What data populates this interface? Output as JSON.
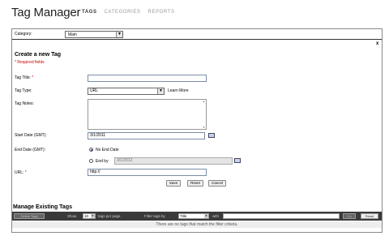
{
  "header": {
    "title": "Tag Manager",
    "tabs": [
      {
        "label": "TAGS"
      },
      {
        "label": "CATEGORIES"
      },
      {
        "label": "REPORTS"
      }
    ]
  },
  "category_bar": {
    "label": "Category:",
    "selected": "Main"
  },
  "close_label": "x",
  "create_form": {
    "title": "Create a new Tag",
    "required_note": "* Required fields",
    "tag_title_label": "Tag Title:",
    "tag_title_value": "",
    "tag_type_label": "Tag Type:",
    "tag_type_value": "URL",
    "learn_more": "Learn More",
    "tag_notes_label": "Tag Notes:",
    "start_date_label": "Start Date (GMT):",
    "start_date_value": "3/1/2011",
    "end_date_label": "End Date (GMT):",
    "no_end_date_label": "No End Date",
    "end_by_label": "End by",
    "end_by_value": "3/1/2012",
    "url_label": "URL:",
    "url_value": "http://",
    "save_label": "Save",
    "reset_label": "Reset",
    "cancel_label": "Cancel"
  },
  "manage": {
    "title": "Manage Existing Tags",
    "delete_label": "Delete Tags",
    "show_label": "Show",
    "per_page_value": "10",
    "per_page_label": "tags per page",
    "filter_label": "Filter tags by",
    "filter_value": "Title",
    "with_label": "with",
    "go_label": "Go",
    "reset_label": "Reset",
    "empty_message": "There are no tags that match the filter criteria."
  },
  "colors": {
    "required": "#cc0000",
    "manage_bar": "#3a3a3a"
  }
}
